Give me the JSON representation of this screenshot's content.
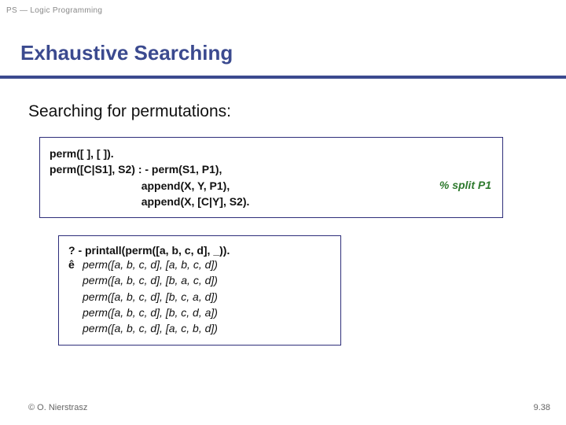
{
  "header": {
    "course_label": "PS — Logic Programming",
    "title": "Exhaustive Searching"
  },
  "subheading": "Searching for permutations:",
  "code": {
    "l1": "perm([ ], [ ]).",
    "l2": "perm([C|S1], S2) : - perm(S1, P1),",
    "l3": "                              append(X, Y, P1),",
    "l4": "                              append(X, [C|Y], S2).",
    "comment": "% split P1"
  },
  "query_box": {
    "query": "? - printall(perm([a, b, c, d], _)).",
    "arrow": "ê",
    "rows": [
      "perm([a, b, c, d], [a, b, c, d])",
      "perm([a, b, c, d], [b, a, c, d])",
      "perm([a, b, c, d], [b, c, a, d])",
      "perm([a, b, c, d], [b, c, d, a])",
      "perm([a, b, c, d], [a, c, b, d])"
    ]
  },
  "footer": {
    "copyright": "© O. Nierstrasz",
    "page": "9.38"
  }
}
